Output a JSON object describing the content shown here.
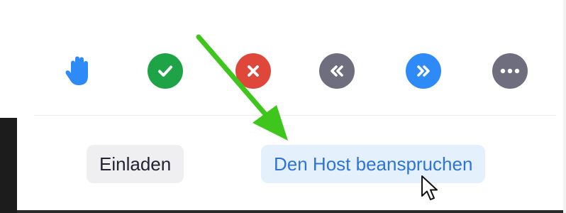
{
  "reactions": [
    {
      "name": "raise-hand",
      "icon": "hand-icon",
      "color": "#2e8af6"
    },
    {
      "name": "yes",
      "icon": "checkmark-icon",
      "color": "#1ea446"
    },
    {
      "name": "no",
      "icon": "close-icon",
      "color": "#e0473b"
    },
    {
      "name": "go-slower",
      "icon": "double-chevron-left-icon",
      "color": "#6e6e7f"
    },
    {
      "name": "go-faster",
      "icon": "double-chevron-right-icon",
      "color": "#2e8af6"
    },
    {
      "name": "more",
      "icon": "more-dots-icon",
      "color": "#6e6e7f"
    }
  ],
  "actions": {
    "invite_label": "Einladen",
    "claim_host_label": "Den Host beanspruchen"
  },
  "annotation": {
    "arrow_color": "#3ec61c",
    "arrow_icon": "green-arrow-icon",
    "cursor_icon": "mouse-pointer-icon"
  },
  "colors": {
    "accent_blue": "#2d74d6",
    "claim_bg": "#e5f0fd",
    "invite_bg": "#efeff2"
  }
}
